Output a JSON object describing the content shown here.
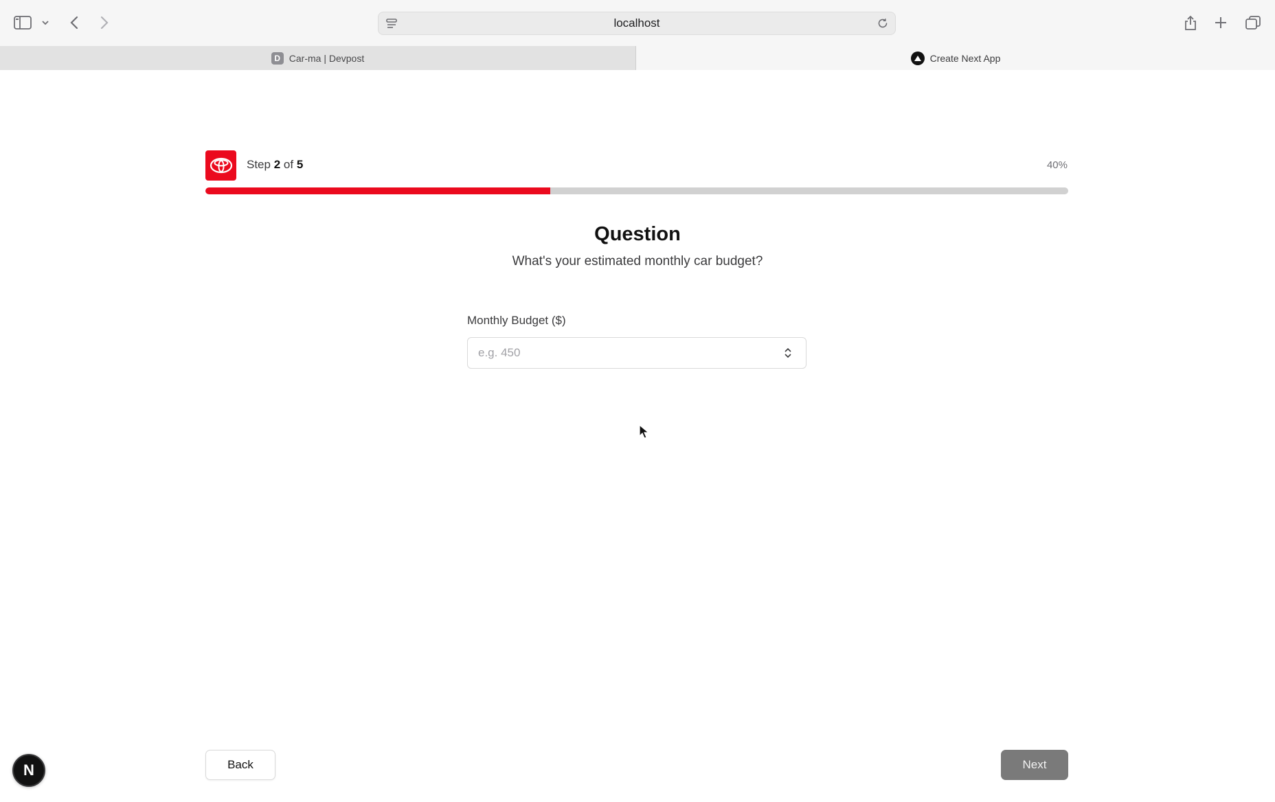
{
  "browser": {
    "address": "localhost",
    "tabs": [
      {
        "label": "Car-ma | Devpost",
        "favicon_letter": "D",
        "active": false
      },
      {
        "label": "Create Next App",
        "active": true
      }
    ]
  },
  "header": {
    "step_label": "Step",
    "step_current": "2",
    "step_of": "of",
    "step_total": "5",
    "percent": "40%",
    "progress_fraction": 0.4
  },
  "question": {
    "title": "Question",
    "subtitle": "What's your estimated monthly car budget?"
  },
  "field": {
    "label": "Monthly Budget ($)",
    "placeholder": "e.g. 450",
    "value": ""
  },
  "nav": {
    "back_label": "Back",
    "next_label": "Next"
  },
  "dev_badge": {
    "label": "N"
  },
  "colors": {
    "brand": "#eb0a1e",
    "track": "#d1d1d1",
    "next_disabled": "#7a7a7a"
  },
  "icons": {
    "sidebar": "sidebar-toggle-icon",
    "back": "chevron-left-icon",
    "forward": "chevron-right-icon",
    "share": "share-icon",
    "new_tab": "plus-icon",
    "tabs_overview": "tabs-overview-icon"
  }
}
